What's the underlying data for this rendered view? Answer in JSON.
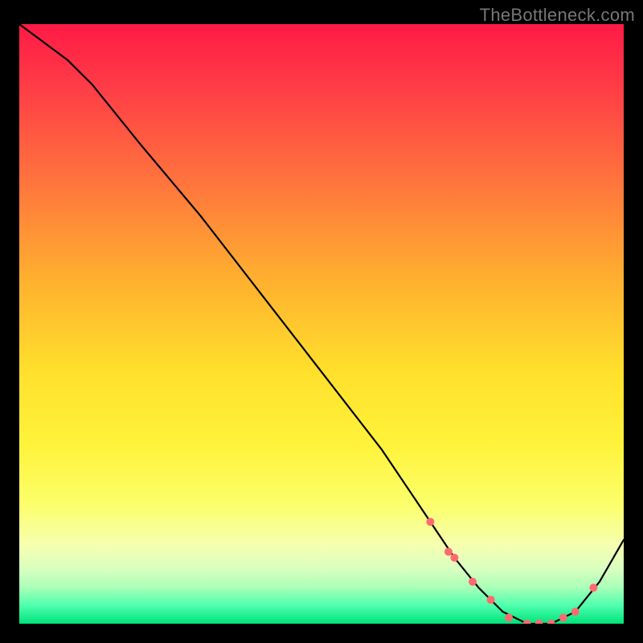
{
  "watermark": "TheBottleneck.com",
  "chart_data": {
    "type": "line",
    "title": "",
    "xlabel": "",
    "ylabel": "",
    "xlim": [
      0,
      100
    ],
    "ylim": [
      0,
      100
    ],
    "grid": false,
    "legend": false,
    "series": [
      {
        "name": "curve",
        "x": [
          0,
          8,
          12,
          20,
          30,
          40,
          50,
          60,
          68,
          72,
          76,
          80,
          84,
          88,
          92,
          96,
          100
        ],
        "values": [
          100,
          94,
          90,
          80,
          68,
          55,
          42,
          29,
          17,
          11,
          6,
          2,
          0,
          0,
          2,
          7,
          14
        ],
        "color": "#000000"
      }
    ],
    "markers": {
      "name": "highlight-points",
      "x": [
        68,
        71,
        72,
        75,
        78,
        81,
        84,
        86,
        88,
        90,
        92,
        95
      ],
      "values": [
        17,
        12,
        11,
        7,
        4,
        1,
        0,
        0,
        0,
        1,
        2,
        6
      ],
      "color": "#ff6a6f",
      "size": 10
    },
    "gradient_stops": [
      {
        "pos": 0,
        "color": "#ff1a45"
      },
      {
        "pos": 10,
        "color": "#ff3b47"
      },
      {
        "pos": 28,
        "color": "#ff7a3c"
      },
      {
        "pos": 42,
        "color": "#ffae2f"
      },
      {
        "pos": 58,
        "color": "#ffe02c"
      },
      {
        "pos": 70,
        "color": "#fff23a"
      },
      {
        "pos": 80,
        "color": "#fcff6a"
      },
      {
        "pos": 87,
        "color": "#f5ffb0"
      },
      {
        "pos": 91,
        "color": "#d8ffc0"
      },
      {
        "pos": 94,
        "color": "#a8ffb8"
      },
      {
        "pos": 97,
        "color": "#4dffad"
      },
      {
        "pos": 100,
        "color": "#00e27a"
      }
    ]
  }
}
